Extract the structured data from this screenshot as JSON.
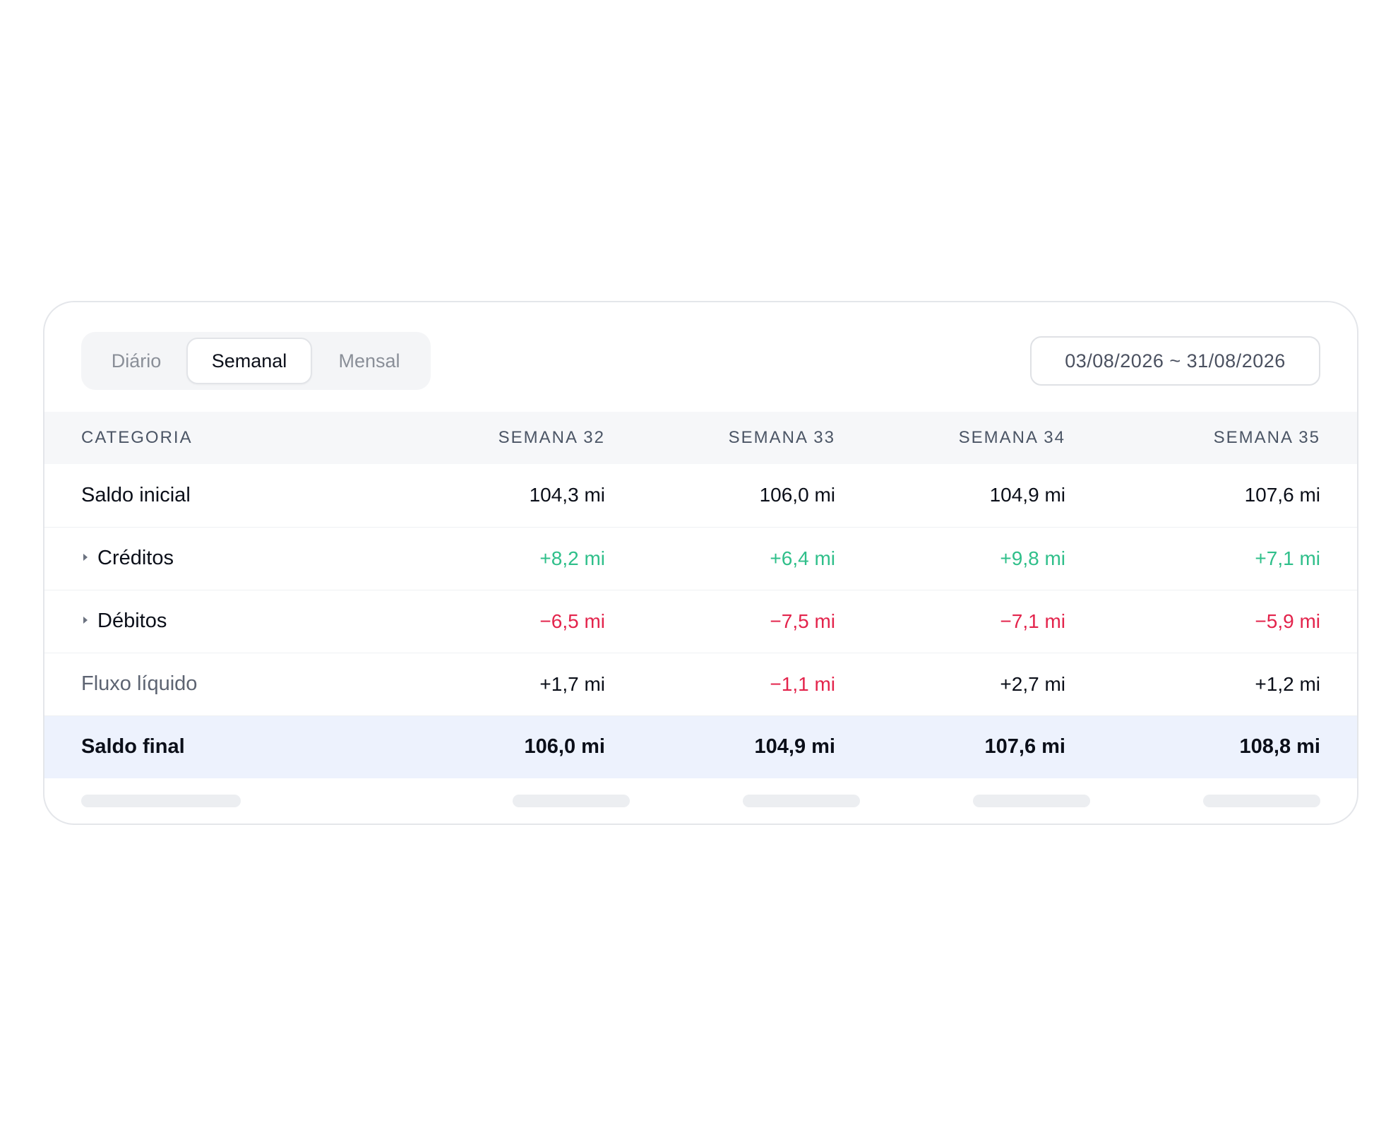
{
  "view_toggle": {
    "options": [
      "Diário",
      "Semanal",
      "Mensal"
    ],
    "selected": "Semanal"
  },
  "date_range": "03/08/2026 ~ 31/08/2026",
  "table": {
    "headers": [
      "CATEGORIA",
      "SEMANA 32",
      "SEMANA 33",
      "SEMANA 34",
      "SEMANA 35"
    ],
    "rows": [
      {
        "label": "Saldo inicial",
        "values": [
          "104,3 mi",
          "106,0 mi",
          "104,9 mi",
          "107,6 mi"
        ]
      },
      {
        "label": "Créditos",
        "values": [
          "+8,2 mi",
          "+6,4 mi",
          "+9,8 mi",
          "+7,1 mi"
        ]
      },
      {
        "label": "Débitos",
        "values": [
          "−6,5 mi",
          "−7,5 mi",
          "−7,1 mi",
          "−5,9 mi"
        ]
      },
      {
        "label": "Fluxo líquido",
        "values": [
          "+1,7 mi",
          "−1,1 mi",
          "+2,7 mi",
          "+1,2 mi"
        ]
      },
      {
        "label": "Saldo final",
        "values": [
          "106,0 mi",
          "104,9 mi",
          "107,6 mi",
          "108,8 mi"
        ]
      }
    ]
  },
  "colors": {
    "positive": "#2fbf8a",
    "negative": "#e3244c",
    "highlight_row": "#edf2fd",
    "header_bg": "#f6f7f9"
  }
}
